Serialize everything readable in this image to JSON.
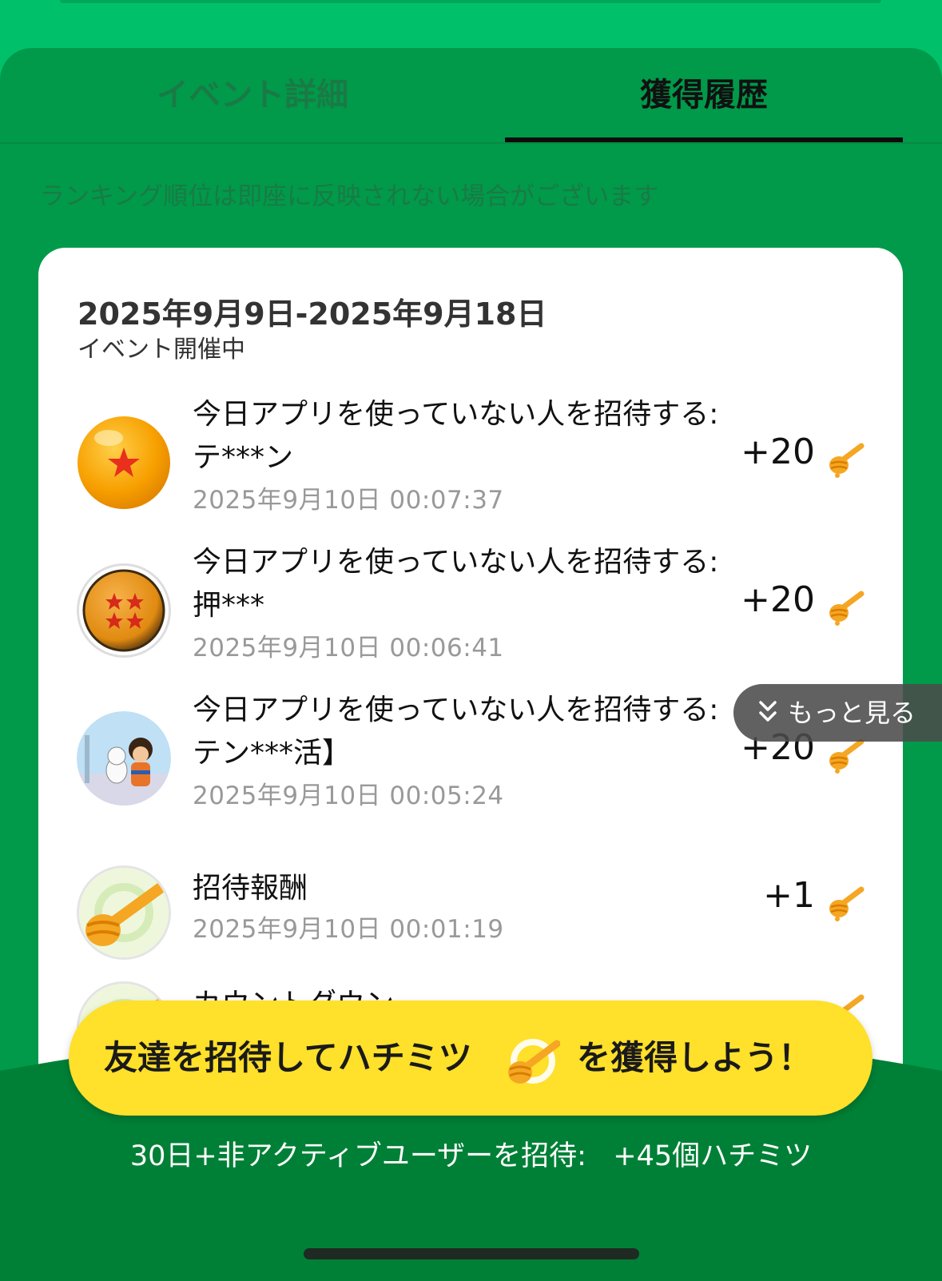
{
  "tabs": [
    {
      "label": "イベント詳細",
      "active": false
    },
    {
      "label": "獲得履歴",
      "active": true
    }
  ],
  "notice": "ランキング順位は即座に反映されない場合がございます",
  "event": {
    "date_range": "2025年9月9日-2025年9月18日",
    "status": "イベント開催中"
  },
  "entries": [
    {
      "title": "今日アプリを使っていない人を招待する:テ***ン",
      "time": "2025年9月10日 00:07:37",
      "points": "+20",
      "avatar": "one-star-dragon-ball-icon"
    },
    {
      "title": "今日アプリを使っていない人を招待する:押***",
      "time": "2025年9月10日 00:06:41",
      "points": "+20",
      "avatar": "four-star-dragon-ball-icon"
    },
    {
      "title": "今日アプリを使っていない人を招待する:テン***活】",
      "time": "2025年9月10日 00:05:24",
      "points": "+20",
      "avatar": "anime-character-avatar"
    },
    {
      "title": "招待報酬",
      "time": "2025年9月10日 00:01:19",
      "points": "+1",
      "avatar": "honey-dipper-avatar"
    },
    {
      "title": "カウントダウン",
      "time": "",
      "points": "",
      "avatar": "honey-dipper-avatar"
    }
  ],
  "more_button": "もっと見る",
  "cta": {
    "left": "友達を招待してハチミツ",
    "right": "を獲得しよう！"
  },
  "subnote": "30日+非アクティブユーザーを招待:   +45個ハチミツ",
  "colors": {
    "background": "#00c16a",
    "panel": "#009a4a",
    "cta": "#ffe02a",
    "honey": "#f5a623"
  },
  "icons": {
    "honey": "honey-dipper-icon",
    "more": "chevron-double-down-icon"
  }
}
